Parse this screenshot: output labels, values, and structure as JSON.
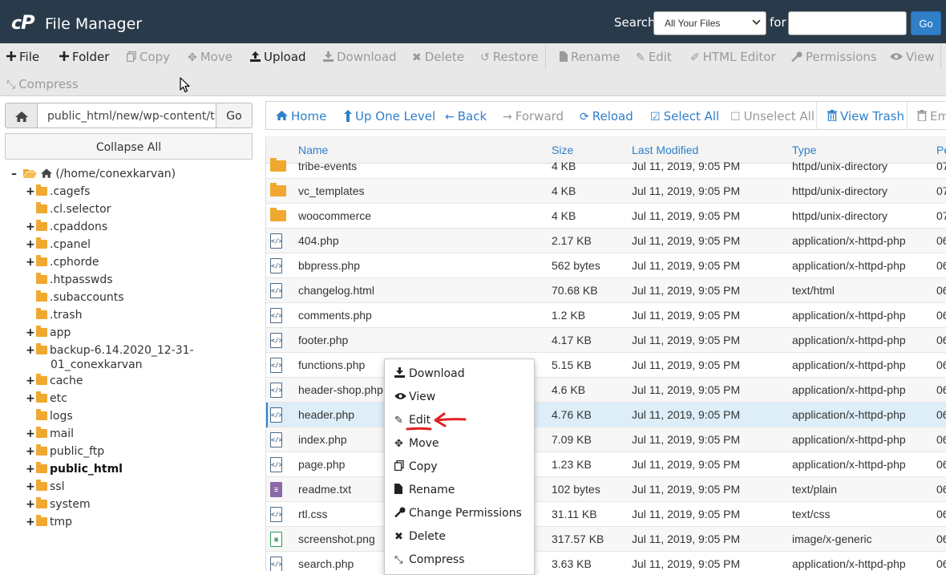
{
  "header": {
    "title": "File Manager",
    "search_label": "Search",
    "search_scope": "All Your Files",
    "for_label": "for",
    "search_value": "",
    "go_label": "Go"
  },
  "toolbar": {
    "file": "File",
    "folder": "Folder",
    "copy": "Copy",
    "move": "Move",
    "upload": "Upload",
    "download": "Download",
    "delete": "Delete",
    "restore": "Restore",
    "rename": "Rename",
    "edit": "Edit",
    "html_editor": "HTML Editor",
    "permissions": "Permissions",
    "view": "View",
    "compress": "Compress"
  },
  "path": {
    "value": "public_html/new/wp-content/tl",
    "go_label": "Go",
    "collapse_all": "Collapse All"
  },
  "tree": {
    "root": "(/home/conexkarvan)",
    "items": [
      {
        "label": ".cagefs",
        "expandable": true
      },
      {
        "label": ".cl.selector",
        "expandable": false
      },
      {
        "label": ".cpaddons",
        "expandable": true
      },
      {
        "label": ".cpanel",
        "expandable": true
      },
      {
        "label": ".cphorde",
        "expandable": true
      },
      {
        "label": ".htpasswds",
        "expandable": false
      },
      {
        "label": ".subaccounts",
        "expandable": false
      },
      {
        "label": ".trash",
        "expandable": false
      },
      {
        "label": "app",
        "expandable": true
      },
      {
        "label": "backup-6.14.2020_12-31-",
        "label2": "01_conexkarvan",
        "expandable": true
      },
      {
        "label": "cache",
        "expandable": true
      },
      {
        "label": "etc",
        "expandable": true
      },
      {
        "label": "logs",
        "expandable": false
      },
      {
        "label": "mail",
        "expandable": true
      },
      {
        "label": "public_ftp",
        "expandable": true
      },
      {
        "label": "public_html",
        "expandable": true,
        "bold": true
      },
      {
        "label": "ssl",
        "expandable": true
      },
      {
        "label": "system",
        "expandable": true
      },
      {
        "label": "tmp",
        "expandable": true
      }
    ]
  },
  "nav": {
    "home": "Home",
    "up_one_level": "Up One Level",
    "back": "Back",
    "forward": "Forward",
    "reload": "Reload",
    "select_all": "Select All",
    "unselect_all": "Unselect All",
    "view_trash": "View Trash",
    "empty_trash_partial": "Em"
  },
  "table": {
    "columns": {
      "name": "Name",
      "size": "Size",
      "last_modified": "Last Modified",
      "type": "Type",
      "perms": "Pe"
    },
    "rows": [
      {
        "name": "tribe-events",
        "size": "4 KB",
        "modified": "Jul 11, 2019, 9:05 PM",
        "type": "httpd/unix-directory",
        "perm": "07",
        "kind": "folder"
      },
      {
        "name": "vc_templates",
        "size": "4 KB",
        "modified": "Jul 11, 2019, 9:05 PM",
        "type": "httpd/unix-directory",
        "perm": "07",
        "kind": "folder"
      },
      {
        "name": "woocommerce",
        "size": "4 KB",
        "modified": "Jul 11, 2019, 9:05 PM",
        "type": "httpd/unix-directory",
        "perm": "07",
        "kind": "folder"
      },
      {
        "name": "404.php",
        "size": "2.17 KB",
        "modified": "Jul 11, 2019, 9:05 PM",
        "type": "application/x-httpd-php",
        "perm": "06",
        "kind": "code"
      },
      {
        "name": "bbpress.php",
        "size": "562 bytes",
        "modified": "Jul 11, 2019, 9:05 PM",
        "type": "application/x-httpd-php",
        "perm": "06",
        "kind": "code"
      },
      {
        "name": "changelog.html",
        "size": "70.68 KB",
        "modified": "Jul 11, 2019, 9:05 PM",
        "type": "text/html",
        "perm": "06",
        "kind": "code"
      },
      {
        "name": "comments.php",
        "size": "1.2 KB",
        "modified": "Jul 11, 2019, 9:05 PM",
        "type": "application/x-httpd-php",
        "perm": "06",
        "kind": "code"
      },
      {
        "name": "footer.php",
        "size": "4.17 KB",
        "modified": "Jul 11, 2019, 9:05 PM",
        "type": "application/x-httpd-php",
        "perm": "06",
        "kind": "code"
      },
      {
        "name": "functions.php",
        "size": "5.15 KB",
        "modified": "Jul 11, 2019, 9:05 PM",
        "type": "application/x-httpd-php",
        "perm": "06",
        "kind": "code"
      },
      {
        "name": "header-shop.php",
        "size": "4.6 KB",
        "modified": "Jul 11, 2019, 9:05 PM",
        "type": "application/x-httpd-php",
        "perm": "06",
        "kind": "code"
      },
      {
        "name": "header.php",
        "size": "4.76 KB",
        "modified": "Jul 11, 2019, 9:05 PM",
        "type": "application/x-httpd-php",
        "perm": "06",
        "kind": "code",
        "selected": true
      },
      {
        "name": "index.php",
        "size": "7.09 KB",
        "modified": "Jul 11, 2019, 9:05 PM",
        "type": "application/x-httpd-php",
        "perm": "06",
        "kind": "code"
      },
      {
        "name": "page.php",
        "size": "1.23 KB",
        "modified": "Jul 11, 2019, 9:05 PM",
        "type": "application/x-httpd-php",
        "perm": "06",
        "kind": "code"
      },
      {
        "name": "readme.txt",
        "size": "102 bytes",
        "modified": "Jul 11, 2019, 9:05 PM",
        "type": "text/plain",
        "perm": "06",
        "kind": "text"
      },
      {
        "name": "rtl.css",
        "size": "31.11 KB",
        "modified": "Jul 11, 2019, 9:05 PM",
        "type": "text/css",
        "perm": "06",
        "kind": "code"
      },
      {
        "name": "screenshot.png",
        "size": "317.57 KB",
        "modified": "Jul 11, 2019, 9:05 PM",
        "type": "image/x-generic",
        "perm": "06",
        "kind": "image"
      },
      {
        "name": "search.php",
        "size": "3.63 KB",
        "modified": "Jul 11, 2019, 9:05 PM",
        "type": "application/x-httpd-php",
        "perm": "06",
        "kind": "code"
      }
    ]
  },
  "context_menu": {
    "items": [
      "Download",
      "View",
      "Edit",
      "Move",
      "Copy",
      "Rename",
      "Change Permissions",
      "Delete",
      "Compress"
    ]
  },
  "colors": {
    "header_bg": "#293a4a",
    "accent_blue": "#2f7fc9",
    "folder": "#f0a830",
    "annotation_red": "#e02020"
  }
}
